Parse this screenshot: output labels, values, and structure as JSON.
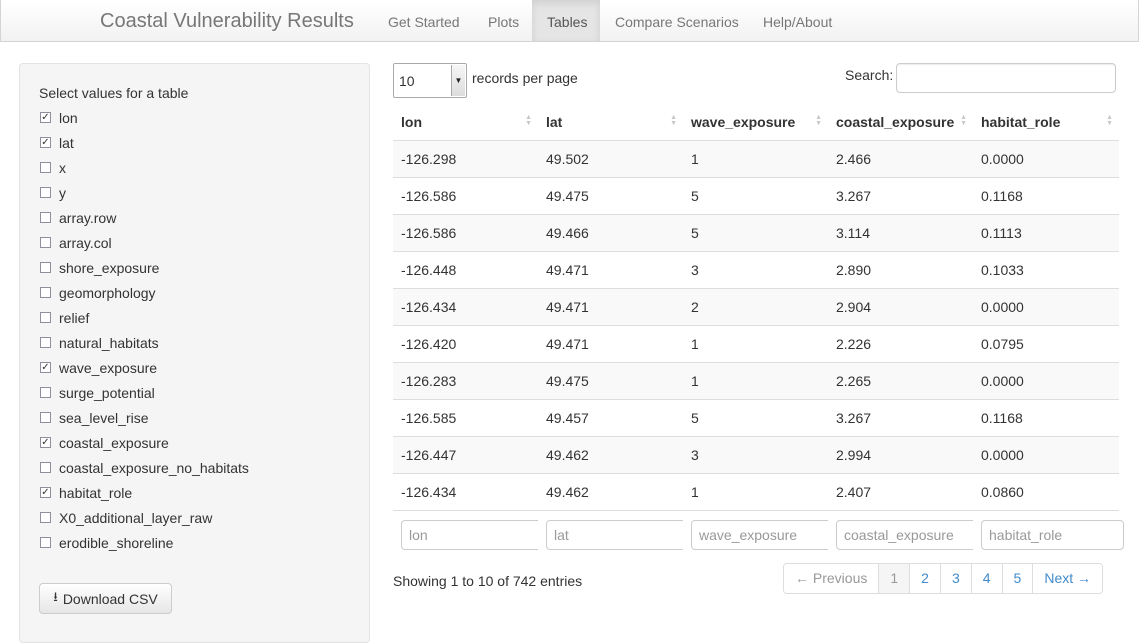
{
  "navbar": {
    "brand": "Coastal Vulnerability Results",
    "tabs": [
      "Get Started",
      "Plots",
      "Tables",
      "Compare Scenarios",
      "Help/About"
    ],
    "active_tab": "Tables"
  },
  "sidebar": {
    "title": "Select values for a table",
    "checkboxes": [
      {
        "label": "lon",
        "checked": true
      },
      {
        "label": "lat",
        "checked": true
      },
      {
        "label": "x",
        "checked": false
      },
      {
        "label": "y",
        "checked": false
      },
      {
        "label": "array.row",
        "checked": false
      },
      {
        "label": "array.col",
        "checked": false
      },
      {
        "label": "shore_exposure",
        "checked": false
      },
      {
        "label": "geomorphology",
        "checked": false
      },
      {
        "label": "relief",
        "checked": false
      },
      {
        "label": "natural_habitats",
        "checked": false
      },
      {
        "label": "wave_exposure",
        "checked": true
      },
      {
        "label": "surge_potential",
        "checked": false
      },
      {
        "label": "sea_level_rise",
        "checked": false
      },
      {
        "label": "coastal_exposure",
        "checked": true
      },
      {
        "label": "coastal_exposure_no_habitats",
        "checked": false
      },
      {
        "label": "habitat_role",
        "checked": true
      },
      {
        "label": "X0_additional_layer_raw",
        "checked": false
      },
      {
        "label": "erodible_shoreline",
        "checked": false
      }
    ],
    "download_label": "Download CSV",
    "download_icon": "download-icon"
  },
  "table": {
    "length_value": "10",
    "length_label": "records per page",
    "search_label": "Search:",
    "search_value": "",
    "columns": [
      "lon",
      "lat",
      "wave_exposure",
      "coastal_exposure",
      "habitat_role"
    ],
    "rows": [
      [
        "-126.298",
        "49.502",
        "1",
        "2.466",
        "0.0000"
      ],
      [
        "-126.586",
        "49.475",
        "5",
        "3.267",
        "0.1168"
      ],
      [
        "-126.586",
        "49.466",
        "5",
        "3.114",
        "0.1113"
      ],
      [
        "-126.448",
        "49.471",
        "3",
        "2.890",
        "0.1033"
      ],
      [
        "-126.434",
        "49.471",
        "2",
        "2.904",
        "0.0000"
      ],
      [
        "-126.420",
        "49.471",
        "1",
        "2.226",
        "0.0795"
      ],
      [
        "-126.283",
        "49.475",
        "1",
        "2.265",
        "0.0000"
      ],
      [
        "-126.585",
        "49.457",
        "5",
        "3.267",
        "0.1168"
      ],
      [
        "-126.447",
        "49.462",
        "3",
        "2.994",
        "0.0000"
      ],
      [
        "-126.434",
        "49.462",
        "1",
        "2.407",
        "0.0860"
      ]
    ],
    "filter_placeholders": [
      "lon",
      "lat",
      "wave_exposure",
      "coastal_exposure",
      "habitat_role"
    ],
    "info": "Showing 1 to 10 of 742 entries",
    "pagination": {
      "previous": "← Previous",
      "pages": [
        "1",
        "2",
        "3",
        "4",
        "5"
      ],
      "current": "1",
      "next": "Next →"
    }
  }
}
